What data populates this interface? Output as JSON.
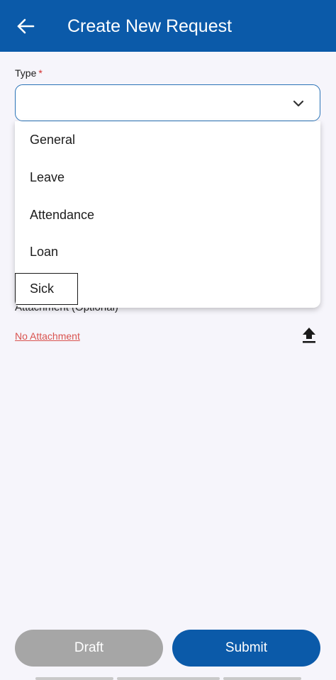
{
  "appbar": {
    "title": "Create New Request",
    "back_icon": "arrow-left-icon",
    "color": "#0b5aa9"
  },
  "form": {
    "type_label": "Type",
    "required_mark": "*",
    "type_value": "",
    "attachment_label": "Attachment (Optional)",
    "no_attachment": "No Attachment",
    "upload_icon": "upload-icon"
  },
  "dropdown": {
    "options": [
      "General",
      "Leave",
      "Attendance",
      "Loan",
      "Sick"
    ],
    "focused_option": "Sick"
  },
  "actions": {
    "draft_label": "Draft",
    "submit_label": "Submit"
  }
}
